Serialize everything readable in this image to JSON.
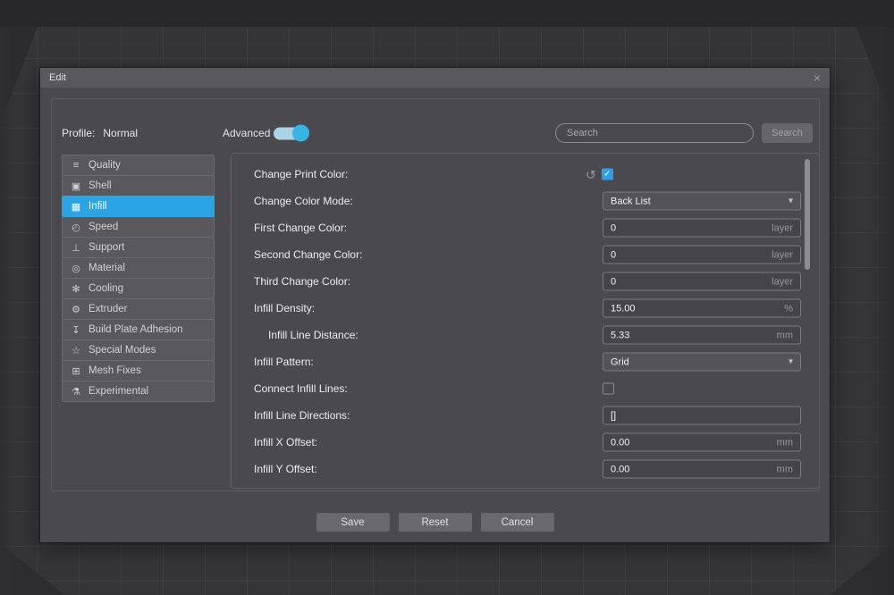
{
  "icons": {
    "close": "×",
    "caret": "▾",
    "reset": "↺",
    "check": "✓"
  },
  "colors": {
    "accent_blue": "#2ba4e4",
    "toggle_cyan": "#3ab3e6"
  },
  "dialog": {
    "title": "Edit"
  },
  "header": {
    "profile_label": "Profile:",
    "profile_value": "Normal",
    "advanced_label": "Advanced",
    "advanced_on": true,
    "search_placeholder": "Search",
    "search_button_label": "Search"
  },
  "sidebar": {
    "selected": "Infill",
    "items": [
      {
        "label": "Quality",
        "icon": "quality-icon",
        "glyph": "≡"
      },
      {
        "label": "Shell",
        "icon": "shell-icon",
        "glyph": "▣"
      },
      {
        "label": "Infill",
        "icon": "infill-icon",
        "glyph": "▦"
      },
      {
        "label": "Speed",
        "icon": "speed-icon",
        "glyph": "◴"
      },
      {
        "label": "Support",
        "icon": "support-icon",
        "glyph": "⊥"
      },
      {
        "label": "Material",
        "icon": "material-icon",
        "glyph": "◎"
      },
      {
        "label": "Cooling",
        "icon": "cooling-icon",
        "glyph": "✻"
      },
      {
        "label": "Extruder",
        "icon": "extruder-icon",
        "glyph": "⚙"
      },
      {
        "label": "Build Plate Adhesion",
        "icon": "build-plate-adhesion-icon",
        "glyph": "↧"
      },
      {
        "label": "Special Modes",
        "icon": "special-modes-icon",
        "glyph": "☆"
      },
      {
        "label": "Mesh Fixes",
        "icon": "mesh-fixes-icon",
        "glyph": "⊞"
      },
      {
        "label": "Experimental",
        "icon": "experimental-icon",
        "glyph": "⚗"
      }
    ]
  },
  "settings": {
    "rows": [
      {
        "label": "Change Print Color:",
        "type": "checkbox",
        "checked": true,
        "has_reset": true
      },
      {
        "label": "Change Color Mode:",
        "type": "dropdown",
        "value": "Back List"
      },
      {
        "label": "First Change Color:",
        "type": "number",
        "value": "0",
        "unit": "layer"
      },
      {
        "label": "Second Change Color:",
        "type": "number",
        "value": "0",
        "unit": "layer"
      },
      {
        "label": "Third Change Color:",
        "type": "number",
        "value": "0",
        "unit": "layer"
      },
      {
        "label": "Infill Density:",
        "type": "number",
        "value": "15.00",
        "unit": "%"
      },
      {
        "label": "Infill Line Distance:",
        "type": "number",
        "value": "5.33",
        "unit": "mm",
        "indented": true
      },
      {
        "label": "Infill Pattern:",
        "type": "dropdown",
        "value": "Grid"
      },
      {
        "label": "Connect Infill Lines:",
        "type": "checkbox",
        "checked": false
      },
      {
        "label": "Infill Line Directions:",
        "type": "text",
        "value": "[]",
        "unit": ""
      },
      {
        "label": "Infill X Offset:",
        "type": "number",
        "value": "0.00",
        "unit": "mm"
      },
      {
        "label": "Infill Y Offset:",
        "type": "number",
        "value": "0.00",
        "unit": "mm"
      }
    ]
  },
  "footer": {
    "save_label": "Save",
    "reset_label": "Reset",
    "cancel_label": "Cancel"
  }
}
